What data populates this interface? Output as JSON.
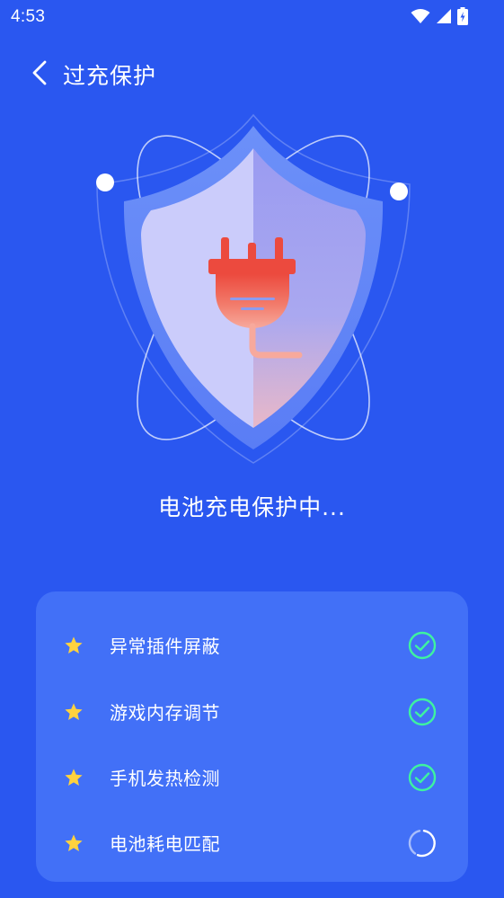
{
  "status_bar": {
    "time": "4:53",
    "icons": [
      "wifi-icon",
      "cellular-signal-icon",
      "battery-charging-icon"
    ]
  },
  "header": {
    "back_icon": "chevron-left-icon",
    "title": "过充保护"
  },
  "illustration": {
    "icons": [
      "shield-icon",
      "power-plug-icon"
    ],
    "colors": {
      "plug": "#ef4b3f",
      "shield_left": "#c9cbfb",
      "shield_right": "#9a9af0"
    }
  },
  "status_text": "电池充电保护中...",
  "checklist": {
    "items": [
      {
        "label": "异常插件屏蔽",
        "status": "done",
        "icon": "check-circle-icon"
      },
      {
        "label": "游戏内存调节",
        "status": "done",
        "icon": "check-circle-icon"
      },
      {
        "label": "手机发热检测",
        "status": "done",
        "icon": "check-circle-icon"
      },
      {
        "label": "电池耗电匹配",
        "status": "in-progress",
        "icon": "loading-spinner-icon"
      }
    ],
    "colors": {
      "star": "#ffd23f",
      "check": "#3ef2a0",
      "card": "#4270f7"
    }
  },
  "colors": {
    "background": "#2a57f0",
    "text": "#ffffff"
  }
}
